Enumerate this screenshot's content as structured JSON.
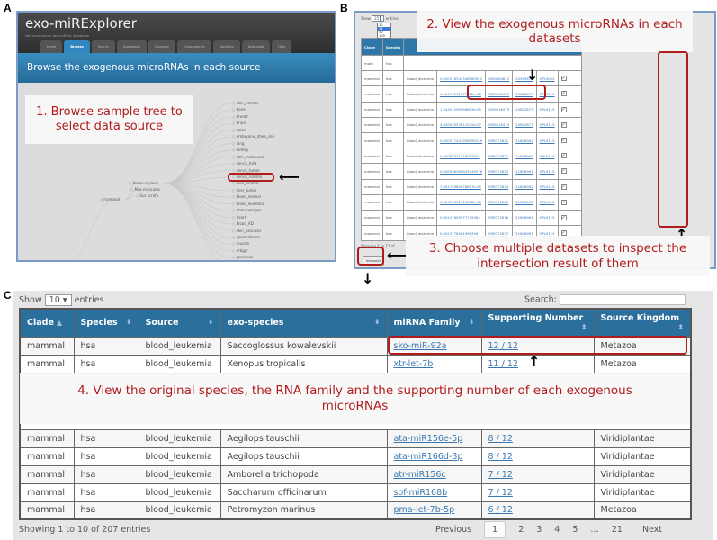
{
  "panel_labels": [
    "A",
    "B",
    "C"
  ],
  "panel_a": {
    "app_title": "exo-miRExplorer",
    "tagline": "the exogenous microRNA database",
    "nav": [
      "Home",
      "Browse",
      "Search",
      "Expression",
      "Compare",
      "Cross-species",
      "Statistics",
      "Download",
      "Help"
    ],
    "active_nav": "Browse",
    "banner": "Browse the exogenous microRNAs in each source",
    "callout": "1. Browse sample tree to select data source",
    "tree": {
      "root": "Metazoa",
      "clade": "mammal",
      "species": [
        "Homo sapiens",
        "Mus musculus",
        "Sus scrofa"
      ],
      "sources": [
        "skin_normal",
        "bone",
        "breast",
        "brain",
        "colon",
        "embryonic_stem_cell",
        "lung",
        "kidney",
        "skin_melanoma",
        "cervix_hela",
        "cervix_tumor",
        "cervix_normal",
        "liver_normal",
        "liver_tumor",
        "blood_normal",
        "blood_leukemia",
        "immuneorgan",
        "heart",
        "blood_AD",
        "skin_psoriasis",
        "spermatozoa",
        "muscle",
        "orbgyr",
        "pancreas",
        "spleen"
      ],
      "selected": "blood_leukemia"
    }
  },
  "panel_b": {
    "show_label": "Show",
    "entries_label": "entries",
    "page_size": "25",
    "page_size_options": [
      "10",
      "25",
      "50",
      "100"
    ],
    "headers": [
      "Clade",
      "Species"
    ],
    "rows": [
      [
        "mammal",
        "hsa",
        "blood_leukemia",
        "0.000318344348980924",
        "GSM494812",
        "20459673",
        "GPL9052"
      ],
      [
        "mammal",
        "hsa",
        "blood_leukemia",
        "1.90174512777322e-06",
        "GSM518472",
        "20622877",
        "GPL9115"
      ],
      [
        "mammal",
        "hsa",
        "blood_leukemia",
        "1.44451599996603e-05",
        "GSM518473",
        "20622877",
        "GPL9115"
      ],
      [
        "mammal",
        "hsa",
        "blood_leukemia",
        "4.82003553812202e-07",
        "GSM518474",
        "20622877",
        "GPL9115"
      ],
      [
        "mammal",
        "hsa",
        "blood_leukemia",
        "0.000377441956595249",
        "SRR172871",
        "21606961",
        "GPL9115"
      ],
      [
        "mammal",
        "hsa",
        "blood_leukemia",
        "0.00087341719052824",
        "SRR172872",
        "21606961",
        "GPL9115"
      ],
      [
        "mammal",
        "hsa",
        "blood_leukemia",
        "0.000938380843749576",
        "SRR172873",
        "21606961",
        "GPL9115"
      ],
      [
        "mammal",
        "hsa",
        "blood_leukemia",
        "7.65179380678897e-05",
        "SRR172874",
        "21606961",
        "GPL9115"
      ],
      [
        "mammal",
        "hsa",
        "blood_leukemia",
        "4.32919631110228e-05",
        "SRR172875",
        "21606961",
        "GPL9115"
      ],
      [
        "mammal",
        "hsa",
        "blood_leukemia",
        "0.00147609977745983",
        "SRR172876",
        "21606961",
        "GPL9115"
      ],
      [
        "mammal",
        "hsa",
        "blood_leukemia",
        "0.0023778584396396",
        "SRR172877",
        "21606961",
        "GPL9115"
      ]
    ],
    "first_row_partial": "mam",
    "first_row_species": "hsa",
    "showing": "Showing 1 to 12 of",
    "intersect_button": "Intersect",
    "callout_2": "2. View the exogenous microRNAs in each datasets",
    "callout_3": "3. Choose multiple datasets to inspect the intersection result of them"
  },
  "panel_c": {
    "show_label": "Show",
    "page_size": "10",
    "entries_label": "entries",
    "search_label": "Search:",
    "search_value": "",
    "headers": [
      "Clade",
      "Species",
      "Source",
      "exo-species",
      "miRNA Family",
      "Supporting Number",
      "Source Kingdom"
    ],
    "rows_top": [
      [
        "mammal",
        "hsa",
        "blood_leukemia",
        "Saccoglossus kowalevskii",
        "sko-miR-92a",
        "12 / 12",
        "Metazoa"
      ],
      [
        "mammal",
        "hsa",
        "blood_leukemia",
        "Xenopus tropicalis",
        "xtr-let-7b",
        "11 / 12",
        "Metazoa"
      ]
    ],
    "rows_bottom": [
      [
        "mammal",
        "hsa",
        "blood_leukemia",
        "Aegilops tauschii",
        "ata-miR156e-5p",
        "8 / 12",
        "Viridiplantae"
      ],
      [
        "mammal",
        "hsa",
        "blood_leukemia",
        "Aegilops tauschii",
        "ata-miR166d-3p",
        "8 / 12",
        "Viridiplantae"
      ],
      [
        "mammal",
        "hsa",
        "blood_leukemia",
        "Amborella trichopoda",
        "atr-miR156c",
        "7 / 12",
        "Viridiplantae"
      ],
      [
        "mammal",
        "hsa",
        "blood_leukemia",
        "Saccharum officinarum",
        "sof-miR168b",
        "7 / 12",
        "Viridiplantae"
      ],
      [
        "mammal",
        "hsa",
        "blood_leukemia",
        "Petromyzon marinus",
        "pma-let-7b-5p",
        "6 / 12",
        "Metazoa"
      ]
    ],
    "callout_4": "4. View the original species, the RNA family and the supporting number of each exogenous microRNAs",
    "showing": "Showing 1 to 10 of 207 entries",
    "pagination": {
      "previous": "Previous",
      "pages": [
        "1",
        "2",
        "3",
        "4",
        "5"
      ],
      "ellipsis": "…",
      "last": "21",
      "next": "Next",
      "current": "1"
    }
  },
  "colors": {
    "annotation_red": "#b01c1c",
    "table_header_blue": "#2b6f9c",
    "link": "#3b78b0"
  }
}
